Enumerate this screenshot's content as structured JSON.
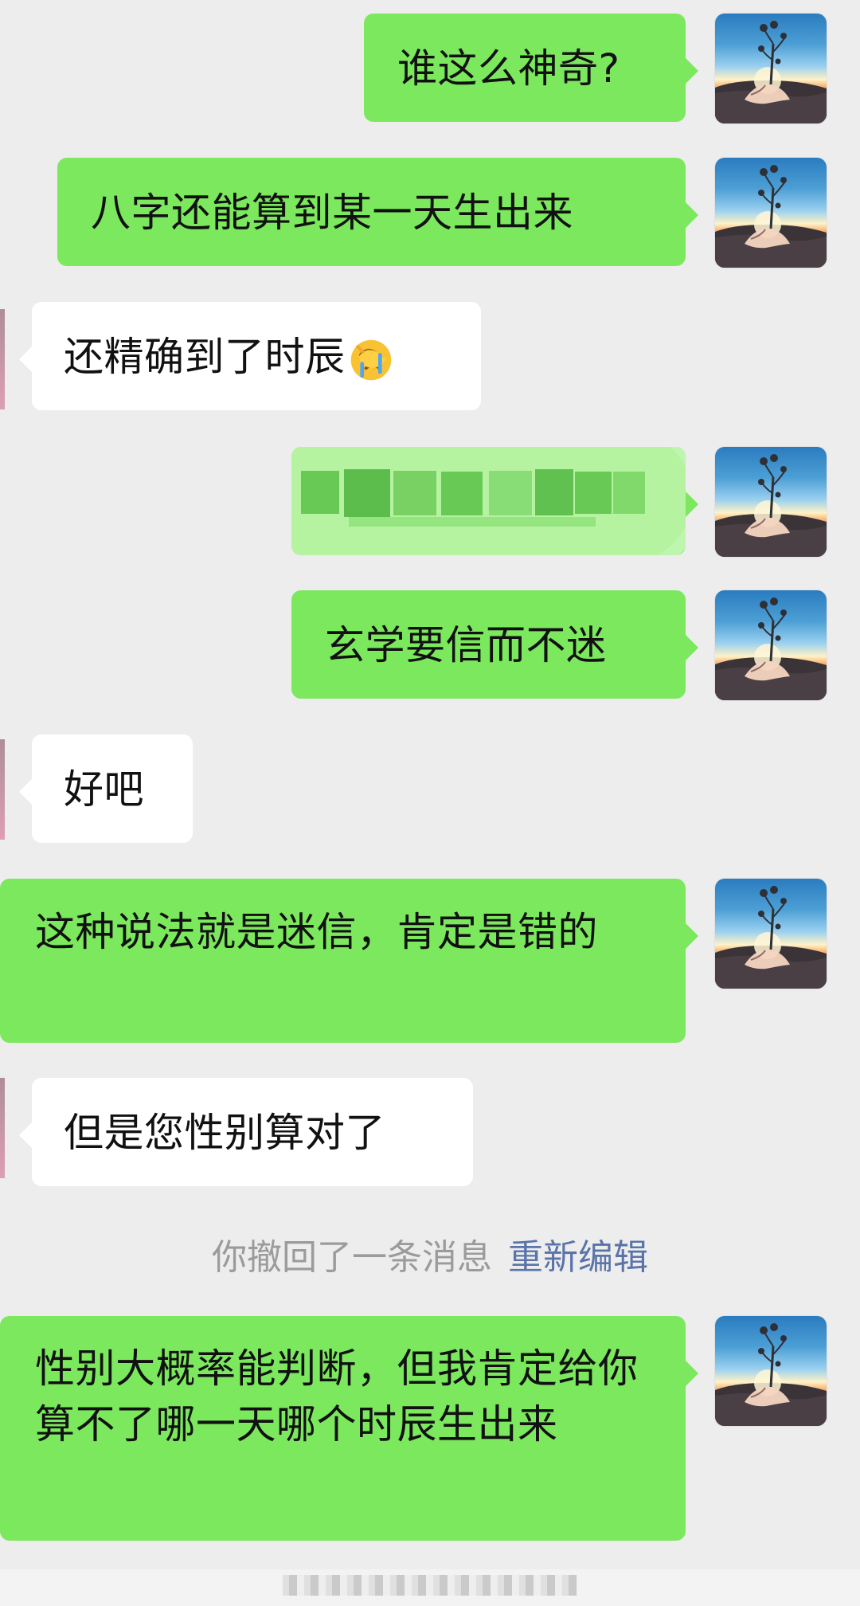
{
  "chat": {
    "messages": [
      {
        "side": "right",
        "text": "谁这么神奇?"
      },
      {
        "side": "right",
        "text": "八字还能算到某一天生出来"
      },
      {
        "side": "left",
        "text": "还精确到了时辰",
        "emoji": "facepalm-crying-emoji"
      },
      {
        "side": "right",
        "text": "",
        "redacted": true
      },
      {
        "side": "right",
        "text": "玄学要信而不迷"
      },
      {
        "side": "left",
        "text": "好吧"
      },
      {
        "side": "right",
        "text": "这种说法就是迷信，肯定是错的"
      },
      {
        "side": "left",
        "text": "但是您性别算对了"
      },
      {
        "side": "right",
        "text": "性别大概率能判断，但我肯定给你算不了哪一天哪个时辰生出来"
      }
    ],
    "recall_notice": "你撤回了一条消息",
    "recall_action": "重新编辑"
  },
  "icons": {
    "avatar": "sunset-hand-avatar",
    "emoji": "facepalm-crying-emoji"
  },
  "colors": {
    "background": "#ededed",
    "outgoing_bubble": "#7be85d",
    "incoming_bubble": "#ffffff",
    "recall_text": "#9b9b9b",
    "recall_link": "#5a74a9"
  }
}
